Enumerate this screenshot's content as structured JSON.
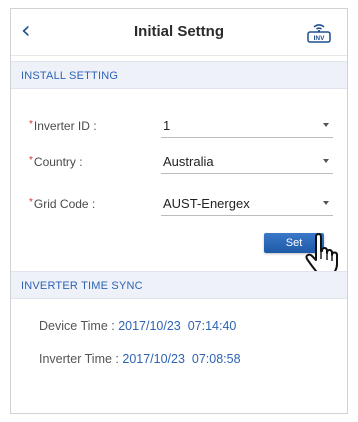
{
  "header": {
    "title": "Initial Settng",
    "back_icon": "chevron-left-icon",
    "right_icon": "inverter-wifi-icon",
    "right_icon_text": "INV"
  },
  "install_section": {
    "title": "INSTALL SETTING",
    "fields": [
      {
        "required": "*",
        "label": "Inverter ID :",
        "value": "1"
      },
      {
        "required": "*",
        "label": "Country :",
        "value": "Australia"
      },
      {
        "required": "*",
        "label": "Grid Code :",
        "value": "AUST-Energex"
      }
    ],
    "set_button": "Set"
  },
  "time_section": {
    "title": "INVERTER TIME SYNC",
    "device_label": "Device Time :",
    "device_value": "2017/10/23  07:14:40",
    "inverter_label": "Inverter Time :",
    "inverter_value": "2017/10/23  07:08:58"
  },
  "colors": {
    "accent": "#2e63b5",
    "button": "#1e5aa8",
    "section_bg": "#eef1f8",
    "required": "#d63030"
  }
}
